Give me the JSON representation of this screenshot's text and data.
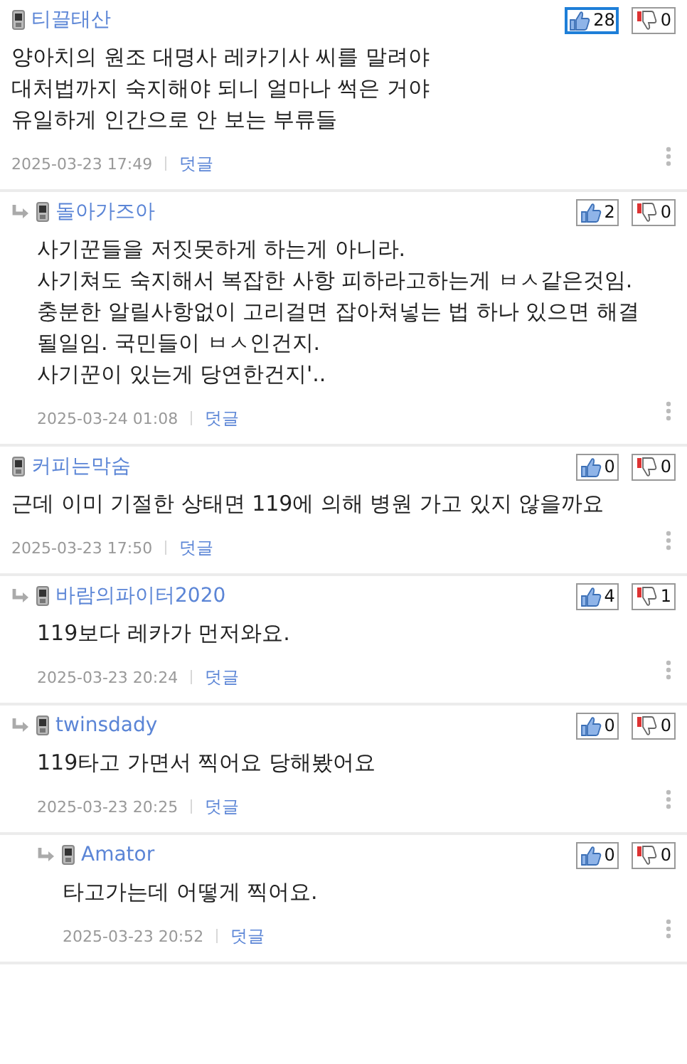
{
  "comments": [
    {
      "author": "티끌태산",
      "body": "양아치의 원조 대명사 레카기사 씨를 말려야\n대처법까지 숙지해야 되니 얼마나 썩은 거야\n유일하게 인간으로 안 보는 부류들",
      "date": "2025-03-23 17:49",
      "reply_label": "덧글",
      "upvote": {
        "count": "28",
        "selected": true
      },
      "downvote": {
        "count": "0",
        "selected": false
      },
      "children": [
        {
          "author": "돌아가즈아",
          "body": "사기꾼들을 저짓못하게 하는게 아니라.\n사기쳐도 숙지해서 복잡한 사항 피하라고하는게 ㅂㅅ같은것임.\n충분한 알릴사항없이 고리걸면 잡아쳐넣는 법 하나 있으면 해결 될일임. 국민들이 ㅂㅅ인건지.\n사기꾼이 있는게 당연한건지'..",
          "date": "2025-03-24 01:08",
          "reply_label": "덧글",
          "upvote": {
            "count": "2",
            "selected": false
          },
          "downvote": {
            "count": "0",
            "selected": false
          }
        }
      ]
    },
    {
      "author": "커피는막숨",
      "body": "근데 이미 기절한 상태면 119에 의해 병원 가고 있지 않을까요",
      "date": "2025-03-23 17:50",
      "reply_label": "덧글",
      "upvote": {
        "count": "0",
        "selected": false
      },
      "downvote": {
        "count": "0",
        "selected": false
      },
      "children": [
        {
          "author": "바람의파이터2020",
          "body": "119보다 레카가 먼저와요.",
          "date": "2025-03-23 20:24",
          "reply_label": "덧글",
          "upvote": {
            "count": "4",
            "selected": false
          },
          "downvote": {
            "count": "1",
            "selected": false
          }
        },
        {
          "author": "twinsdady",
          "body": "119타고 가면서 찍어요 당해봤어요",
          "date": "2025-03-23 20:25",
          "reply_label": "덧글",
          "upvote": {
            "count": "0",
            "selected": false
          },
          "downvote": {
            "count": "0",
            "selected": false
          },
          "children": [
            {
              "author": "Amator",
              "body": "타고가는데 어떻게 찍어요.",
              "date": "2025-03-23 20:52",
              "reply_label": "덧글",
              "upvote": {
                "count": "0",
                "selected": false
              },
              "downvote": {
                "count": "0",
                "selected": false
              }
            }
          ]
        }
      ]
    }
  ]
}
